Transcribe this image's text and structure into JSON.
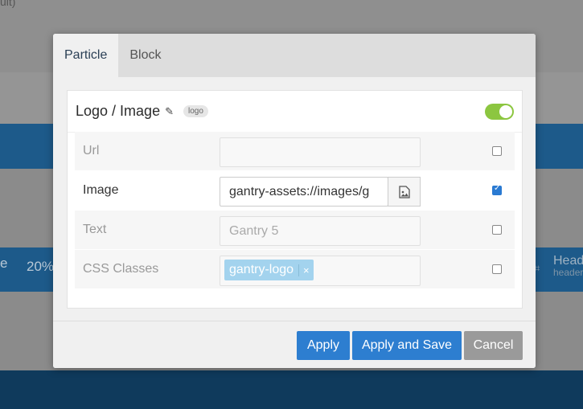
{
  "background": {
    "top_text": "ult)",
    "percent": "20%",
    "left_text": "e",
    "right_title": "Head",
    "right_sub": "header"
  },
  "modal": {
    "tabs": [
      {
        "label": "Particle",
        "active": true
      },
      {
        "label": "Block",
        "active": false
      }
    ],
    "particle": {
      "title": "Logo / Image",
      "badge": "logo",
      "enabled": true
    },
    "fields": [
      {
        "label": "Url",
        "value": "",
        "checked": false
      },
      {
        "label": "Image",
        "value": "gantry-assets://images/g",
        "checked": true
      },
      {
        "label": "Text",
        "placeholder": "Gantry 5",
        "checked": false
      },
      {
        "label": "CSS Classes",
        "tag": "gantry-logo",
        "tag_remove": "×",
        "checked": false
      }
    ],
    "buttons": {
      "apply": "Apply",
      "apply_save": "Apply and Save",
      "cancel": "Cancel"
    }
  },
  "colors": {
    "primary": "#2d7ed0",
    "toggle_on": "#8cc640",
    "tag": "#a3d3ee"
  }
}
